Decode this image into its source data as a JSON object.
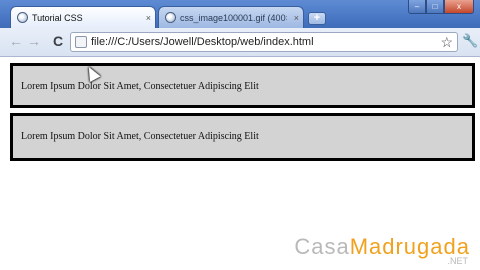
{
  "browser": {
    "tabs": [
      {
        "label": "Tutorial CSS",
        "close": "×"
      },
      {
        "label": "css_image100001.gif (400×3",
        "close": "×"
      }
    ],
    "new_tab": "+",
    "window_buttons": {
      "minimize": "–",
      "maximize": "□",
      "close": "x"
    },
    "nav": {
      "back": "←",
      "forward": "→",
      "reload": "C"
    },
    "address": "file:///C:/Users/Jowell/Desktop/web/index.html",
    "star": "☆",
    "wrench": "🔧"
  },
  "page": {
    "paragraphs": [
      "Lorem Ipsum Dolor Sit Amet, Consectetuer Adipiscing Elit",
      "Lorem Ipsum Dolor Sit Amet, Consectetuer Adipiscing Elit"
    ]
  },
  "watermark": {
    "part1": "Casa",
    "part2": "Madrugada",
    "suffix": ".NET"
  },
  "colors": {
    "box_bg": "#d3d3d3",
    "box_border": "#000000",
    "brand_orange": "#f0a21f"
  }
}
